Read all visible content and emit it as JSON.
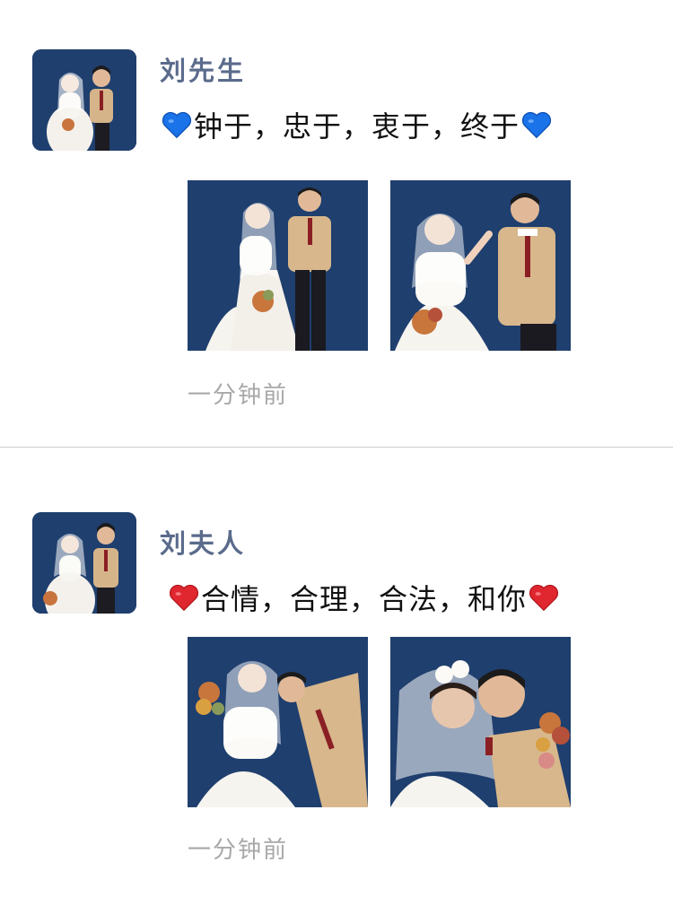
{
  "posts": [
    {
      "author": "刘先生",
      "caption_text": "钟于，忠于，衷于，终于",
      "heart_icon": "blue-heart-icon",
      "heart_color": "#1a73e8",
      "time": "一分钟前"
    },
    {
      "author": "刘夫人",
      "caption_text": "合情，合理，合法，和你",
      "heart_icon": "red-heart-icon",
      "heart_color": "#e0262e",
      "time": "一分钟前"
    }
  ],
  "colors": {
    "name": "#5b6b8c",
    "time": "#a8a8a8",
    "photo_background": "#1f3f6e",
    "divider": "#cfcfcf"
  }
}
